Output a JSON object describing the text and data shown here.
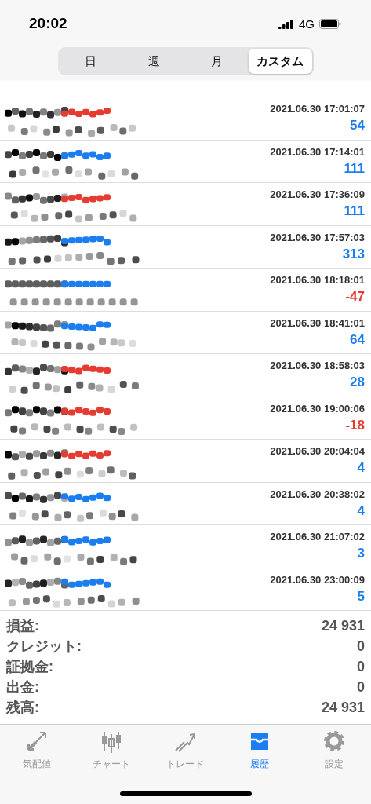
{
  "status_bar": {
    "time": "20:02",
    "network": "4G"
  },
  "segments": [
    {
      "label": "日",
      "selected": false
    },
    {
      "label": "週",
      "selected": false
    },
    {
      "label": "月",
      "selected": false
    },
    {
      "label": "カスタム",
      "selected": true
    }
  ],
  "deals": [
    {
      "color": "#e53b30",
      "time": "2021.06.30 17:01:07",
      "profit": "54",
      "negative": false
    },
    {
      "color": "#1a7ef0",
      "time": "2021.06.30 17:14:01",
      "profit": "111",
      "negative": false
    },
    {
      "color": "#e53b30",
      "time": "2021.06.30 17:36:09",
      "profit": "111",
      "negative": false
    },
    {
      "color": "#1a7ef0",
      "time": "2021.06.30 17:57:03",
      "profit": "313",
      "negative": false
    },
    {
      "color": "#1a7ef0",
      "time": "2021.06.30 18:18:01",
      "profit": "-47",
      "negative": true
    },
    {
      "color": "#1a7ef0",
      "time": "2021.06.30 18:41:01",
      "profit": "64",
      "negative": false
    },
    {
      "color": "#e53b30",
      "time": "2021.06.30 18:58:03",
      "profit": "28",
      "negative": false
    },
    {
      "color": "#e53b30",
      "time": "2021.06.30 19:00:06",
      "profit": "-18",
      "negative": true
    },
    {
      "color": "#e53b30",
      "time": "2021.06.30 20:04:04",
      "profit": "4",
      "negative": false
    },
    {
      "color": "#1a7ef0",
      "time": "2021.06.30 20:38:02",
      "profit": "4",
      "negative": false
    },
    {
      "color": "#1a7ef0",
      "time": "2021.06.30 21:07:02",
      "profit": "3",
      "negative": false
    },
    {
      "color": "#1a7ef0",
      "time": "2021.06.30 23:00:09",
      "profit": "5",
      "negative": false
    }
  ],
  "summary": [
    {
      "label": "損益:",
      "value": "24 931"
    },
    {
      "label": "クレジット:",
      "value": "0"
    },
    {
      "label": "証拠金:",
      "value": "0"
    },
    {
      "label": "出金:",
      "value": "0"
    },
    {
      "label": "残高:",
      "value": "24 931"
    }
  ],
  "tab_bar": [
    {
      "label": "気配値",
      "kind": "quotes",
      "selected": false
    },
    {
      "label": "チャート",
      "kind": "chart",
      "selected": false
    },
    {
      "label": "トレード",
      "kind": "trade",
      "selected": false
    },
    {
      "label": "履歴",
      "kind": "history",
      "selected": true
    },
    {
      "label": "設定",
      "kind": "settings",
      "selected": false
    }
  ]
}
